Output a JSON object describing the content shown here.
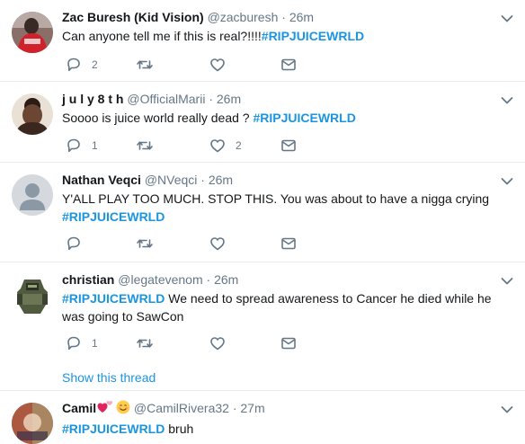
{
  "tweets": [
    {
      "name": "Zac Buresh (Kid Vision)",
      "handle": "@zacburesh",
      "sep": "·",
      "time": "26m",
      "text": "Can anyone tell me if this is real?!!!!",
      "tag": "#RIPJUICEWRLD",
      "replies": "2",
      "likes": ""
    },
    {
      "name": "j u l y 8 t h",
      "handle": "@OfficialMarii",
      "sep": "·",
      "time": "26m",
      "text": "Soooo is juice world really dead ?",
      "tag": "#RIPJUICEWRLD",
      "replies": "1",
      "likes": "2"
    },
    {
      "name": "Nathan Veqci",
      "handle": "@NVeqci",
      "sep": "·",
      "time": "26m",
      "text": "Y'ALL PLAY TOO MUCH. STOP THIS. You was about to have a nigga crying",
      "tag": "#RIPJUICEWRLD",
      "replies": "",
      "likes": ""
    },
    {
      "name": "christian",
      "handle": "@legatevenom",
      "sep": "·",
      "time": "26m",
      "tag": "#RIPJUICEWRLD",
      "text": "We need to spread awareness to Cancer he died while he was going to SawCon",
      "replies": "1",
      "likes": "",
      "thread": "Show this thread"
    },
    {
      "name": "Camil",
      "handle": "@CamilRivera32",
      "sep": "·",
      "time": "27m",
      "tag": "#RIPJUICEWRLD",
      "text": "bruh"
    }
  ],
  "icons": [
    "reply-icon",
    "retweet-icon",
    "like-icon",
    "direct-message-icon",
    "chevron-down-icon",
    "heart-emoji-icon",
    "smile-emoji-icon"
  ],
  "colors": {
    "link": "#1b95e0",
    "muted": "#657786",
    "divider": "#e6ecf0"
  }
}
